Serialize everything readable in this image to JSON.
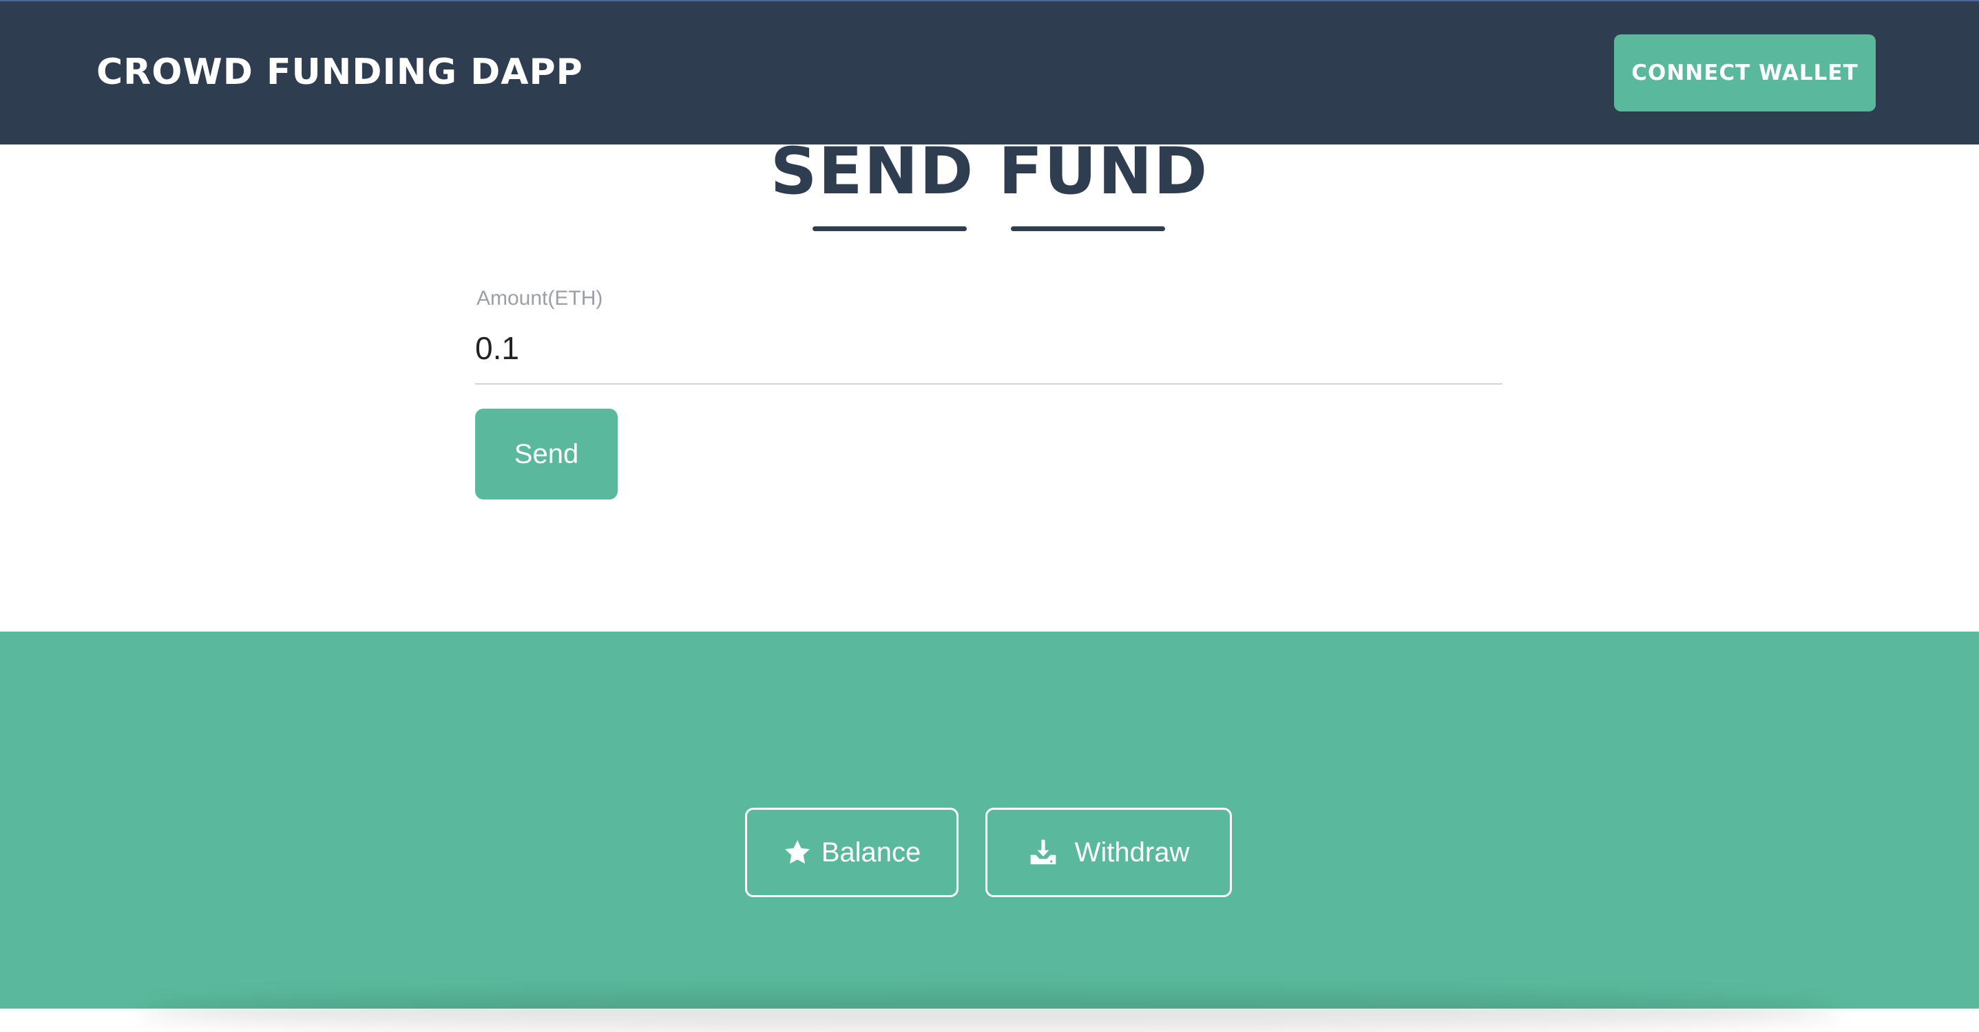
{
  "navbar": {
    "brand": "CROWD FUNDING DAPP",
    "connect_wallet_label": "CONNECT WALLET"
  },
  "send_fund": {
    "title": "SEND FUND",
    "amount_label": "Amount(ETH)",
    "amount_value": "0.1",
    "send_label": "Send"
  },
  "actions": {
    "balance_label": "Balance",
    "withdraw_label": "Withdraw"
  },
  "icons": {
    "balance": "star-icon",
    "withdraw": "download-icon"
  },
  "colors": {
    "navbar_bg": "#2f3d50",
    "accent": "#5ab99c",
    "title": "#2f3d50"
  }
}
